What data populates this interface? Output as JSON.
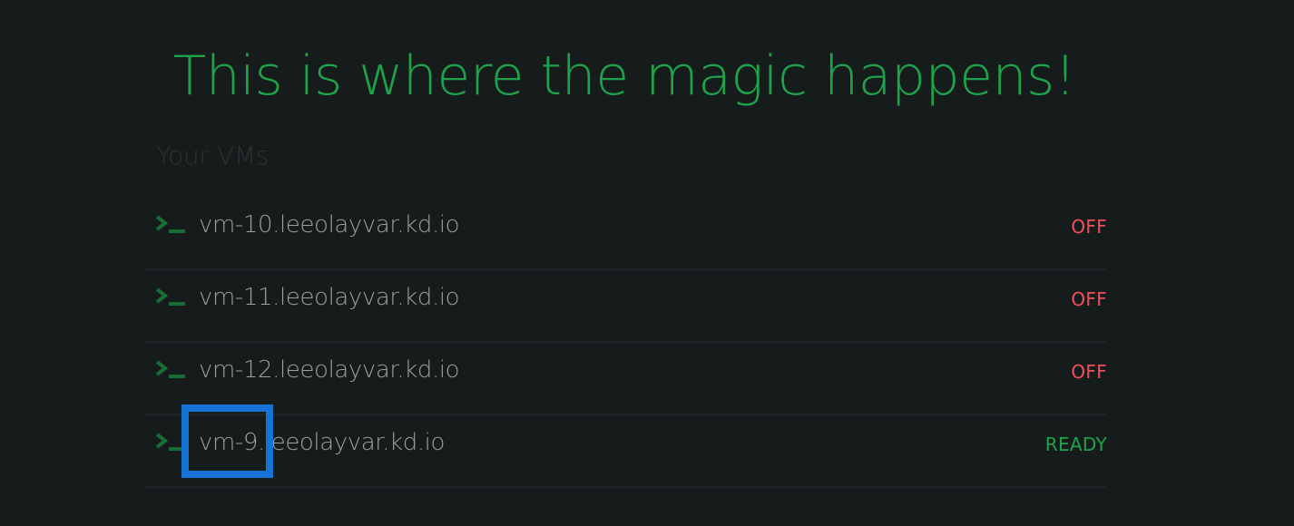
{
  "headline": "This is where the magic happens!",
  "section_label": "Your VMs",
  "vms": [
    {
      "name": "vm-10.leeolayvar.kd.io",
      "status": "OFF",
      "status_color": "#f0505a",
      "icon": "terminal-icon"
    },
    {
      "name": "vm-11.leeolayvar.kd.io",
      "status": "OFF",
      "status_color": "#f0505a",
      "icon": "terminal-icon"
    },
    {
      "name": "vm-12.leeolayvar.kd.io",
      "status": "OFF",
      "status_color": "#f0505a",
      "icon": "terminal-icon"
    },
    {
      "name": "vm-9.leeolayvar.kd.io",
      "status": "READY",
      "status_color": "#1fa34a",
      "icon": "terminal-icon"
    }
  ],
  "colors": {
    "background": "#161b1c",
    "accent_green": "#1fa34a",
    "off_red": "#f0505a",
    "highlight_blue": "#1573d6"
  }
}
